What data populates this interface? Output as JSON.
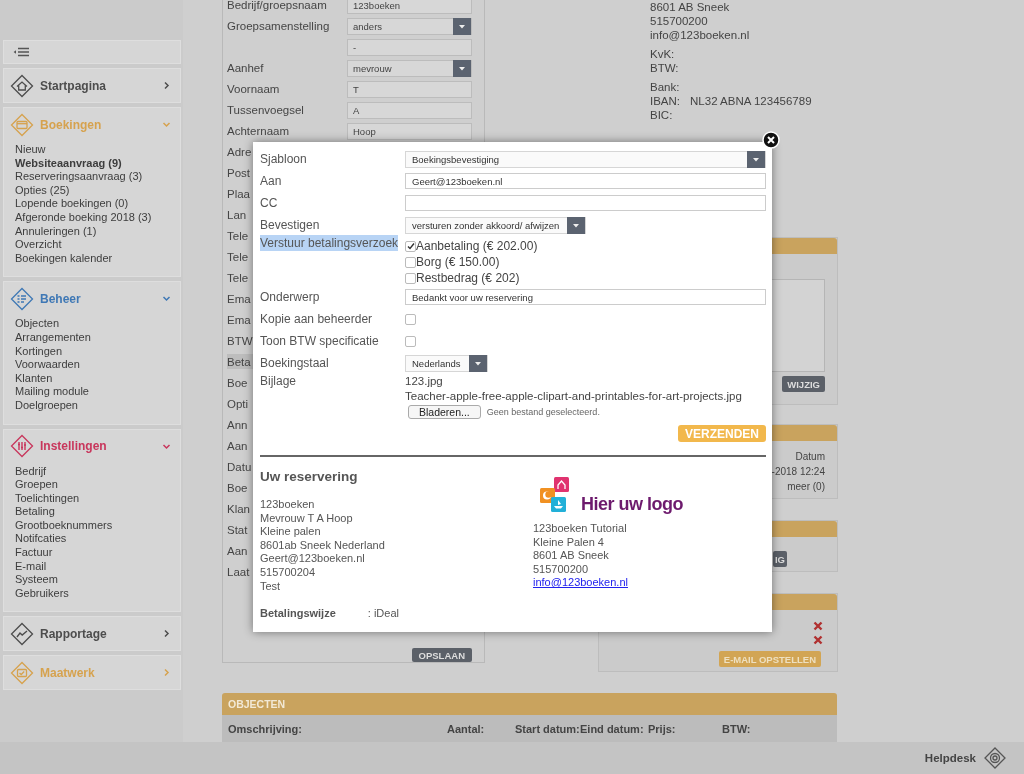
{
  "sidebar": {
    "sections": [
      {
        "title": "Startpagina",
        "color": "#4d4d4d",
        "expanded": false
      },
      {
        "title": "Boekingen",
        "color": "#d6a24e",
        "expanded": true,
        "items": [
          {
            "label": "Nieuw",
            "emphasized": false
          },
          {
            "label": "Websiteaanvraag (9)",
            "emphasized": true
          },
          {
            "label": "Reserveringsaanvraag (3)",
            "emphasized": false
          },
          {
            "label": "Opties (25)",
            "emphasized": false
          },
          {
            "label": "Lopende boekingen (0)",
            "emphasized": false
          },
          {
            "label": "Afgeronde boeking 2018 (3)",
            "emphasized": false
          },
          {
            "label": "Annuleringen (1)",
            "emphasized": false
          },
          {
            "label": "Overzicht",
            "emphasized": false
          },
          {
            "label": "Boekingen kalender",
            "emphasized": false
          }
        ]
      },
      {
        "title": "Beheer",
        "color": "#3f78b5",
        "expanded": true,
        "items": [
          {
            "label": "Objecten",
            "emphasized": false
          },
          {
            "label": "Arrangementen",
            "emphasized": false
          },
          {
            "label": "Kortingen",
            "emphasized": false
          },
          {
            "label": "Voorwaarden",
            "emphasized": false
          },
          {
            "label": "Klanten",
            "emphasized": false
          },
          {
            "label": "Mailing module",
            "emphasized": false
          },
          {
            "label": "Doelgroepen",
            "emphasized": false
          }
        ]
      },
      {
        "title": "Instellingen",
        "color": "#c8365c",
        "expanded": true,
        "items": [
          {
            "label": "Bedrijf",
            "emphasized": false
          },
          {
            "label": "Groepen",
            "emphasized": false
          },
          {
            "label": "Toelichtingen",
            "emphasized": false
          },
          {
            "label": "Betaling",
            "emphasized": false
          },
          {
            "label": "Grootboeknummers",
            "emphasized": false
          },
          {
            "label": "Notifcaties",
            "emphasized": false
          },
          {
            "label": "Factuur",
            "emphasized": false
          },
          {
            "label": "E-mail",
            "emphasized": false
          },
          {
            "label": "Systeem",
            "emphasized": false
          },
          {
            "label": "Gebruikers",
            "emphasized": false
          }
        ]
      },
      {
        "title": "Rapportage",
        "color": "#4d4d4d",
        "expanded": false
      },
      {
        "title": "Maatwerk",
        "color": "#d6a24e",
        "expanded": false
      }
    ]
  },
  "customer_form": {
    "rows": [
      {
        "label": "Bedrijf/groepsnaam",
        "kind": "text",
        "value": "123boeken",
        "highlighted": false
      },
      {
        "label": "Groepsamenstelling",
        "kind": "select",
        "value": "anders",
        "highlighted": false
      },
      {
        "kind": "text",
        "value": "-",
        "highlighted": false
      },
      {
        "label": "Aanhef",
        "kind": "select",
        "value": "mevrouw",
        "highlighted": false
      },
      {
        "label": "Voornaam",
        "kind": "text",
        "value": "T",
        "highlighted": false
      },
      {
        "label": "Tussenvoegsel",
        "kind": "text",
        "value": "A",
        "highlighted": false
      },
      {
        "label": "Achternaam",
        "kind": "text",
        "value": "Hoop",
        "highlighted": false
      },
      {
        "label": "Adre",
        "kind": "covered",
        "highlighted": false
      },
      {
        "label": "Post",
        "kind": "covered",
        "highlighted": false
      },
      {
        "label": "Plaa",
        "kind": "covered",
        "highlighted": false
      },
      {
        "label": "Lan",
        "kind": "covered",
        "highlighted": false
      },
      {
        "label": "Tele",
        "kind": "covered",
        "highlighted": false
      },
      {
        "label": "Tele",
        "kind": "covered",
        "highlighted": false
      },
      {
        "label": "Tele",
        "kind": "covered",
        "highlighted": false
      },
      {
        "label": "Ema",
        "kind": "covered",
        "highlighted": false
      },
      {
        "label": "Ema",
        "kind": "covered",
        "highlighted": false
      },
      {
        "label": "BTW",
        "kind": "covered",
        "highlighted": false
      },
      {
        "label": "Beta",
        "kind": "covered",
        "highlighted": true
      },
      {
        "label": "Boe",
        "kind": "covered",
        "highlighted": false
      },
      {
        "label": "Opti",
        "kind": "covered",
        "highlighted": false
      },
      {
        "label": "Ann",
        "kind": "covered",
        "highlighted": false
      },
      {
        "label": "Aan",
        "kind": "covered",
        "highlighted": false
      },
      {
        "label": "Datu",
        "kind": "covered",
        "highlighted": false
      },
      {
        "label": "Boe",
        "kind": "covered",
        "highlighted": false
      },
      {
        "label": "Klan",
        "kind": "covered",
        "highlighted": false
      },
      {
        "label": "Stat",
        "kind": "covered",
        "highlighted": false
      },
      {
        "label": "Aan",
        "kind": "covered",
        "highlighted": false
      },
      {
        "label": "Laat",
        "kind": "covered",
        "highlighted": false
      }
    ],
    "save_button": "OPSLAAN"
  },
  "company_info": {
    "lines": [
      "8601 AB Sneek",
      "515700200",
      "info@123boeken.nl"
    ],
    "registration": [
      "KvK:",
      "BTW:"
    ],
    "bank": [
      {
        "label": "Bank:"
      },
      {
        "label": "IBAN:",
        "value": "NL32 ABNA 123456789"
      },
      {
        "label": "BIC:"
      }
    ]
  },
  "side_panels": [
    {
      "kind": "note",
      "button": "WIJZIG"
    },
    {
      "kind": "dates",
      "lines": [
        "Datum",
        "-2018 12:24",
        "meer (0)"
      ]
    },
    {
      "kind": "button",
      "button": "IG"
    },
    {
      "kind": "list",
      "rows": [
        {
          "removable": true
        },
        {
          "removable": true
        }
      ],
      "button": "E-MAIL OPSTELLEN"
    }
  ],
  "objects_table": {
    "title": "OBJECTEN",
    "columns": [
      "Omschrijving:",
      "Aantal:",
      "Start datum:",
      "Eind datum:",
      "Prijs:",
      "BTW:"
    ]
  },
  "helpdesk": {
    "label": "Helpdesk"
  },
  "email_dialog": {
    "fields": [
      {
        "label": "Sjabloon",
        "kind": "select",
        "value": "Boekingsbevestiging",
        "highlighted": false
      },
      {
        "label": "Aan",
        "kind": "text",
        "value": "Geert@123boeken.nl",
        "highlighted": false
      },
      {
        "label": "CC",
        "kind": "text",
        "highlighted": false
      },
      {
        "label": "Bevestigen",
        "kind": "select",
        "value": "versturen zonder akkoord/ afwijzen",
        "highlighted": false
      },
      {
        "label": "Verstuur betalingsverzoek",
        "kind": "checklist",
        "highlighted": true,
        "options": [
          {
            "label": "Aanbetaling (€ 202.00)",
            "checked": true
          },
          {
            "label": "Borg (€ 150.00)",
            "checked": false
          },
          {
            "label": "Restbedrag (€ 202)",
            "checked": false
          }
        ]
      },
      {
        "label": "Onderwerp",
        "kind": "text",
        "value": "Bedankt voor uw reservering",
        "highlighted": false
      },
      {
        "label": "Kopie aan beheerder",
        "kind": "checkbox",
        "checked": false,
        "highlighted": false
      },
      {
        "label": "Toon BTW specificatie",
        "kind": "checkbox",
        "checked": false,
        "highlighted": false
      },
      {
        "label": "Boekingstaal",
        "kind": "select",
        "value": "Nederlands",
        "highlighted": false
      },
      {
        "label": "Bijlage",
        "kind": "files",
        "files": [
          "123.jpg",
          "Teacher-apple-free-apple-clipart-and-printables-for-art-projects.jpg"
        ],
        "browse_button": "Bladeren...",
        "file_status": "Geen bestand geselecteerd.",
        "highlighted": false
      }
    ],
    "send_button": "VERZENDEN",
    "summary": {
      "title": "Uw reservering",
      "customer_lines": [
        "123boeken",
        "Mevrouw T A Hoop",
        "Kleine palen",
        "8601ab Sneek Nederland",
        "Geert@123boeken.nl",
        "515700204",
        "Test"
      ],
      "logo_text": "Hier uw logo",
      "company_lines": [
        "123boeken Tutorial",
        "Kleine Palen 4",
        "8601 AB Sneek",
        "515700200"
      ],
      "company_email": "info@123boeken.nl",
      "payment_label": "Betalingswijze",
      "payment_value": ": iDeal"
    }
  }
}
